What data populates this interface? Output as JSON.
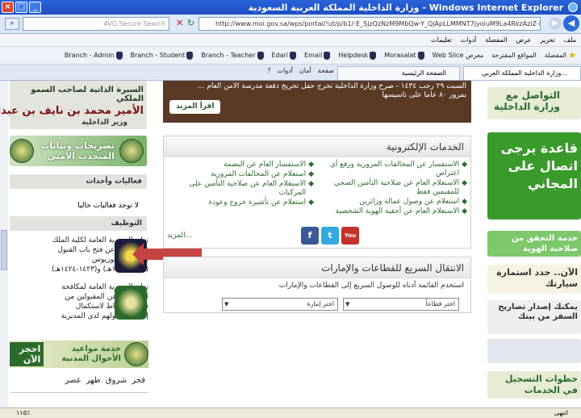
{
  "window": {
    "title": "وزارة الداخلية المملكة العربية السعودية - Windows Internet Explorer"
  },
  "address": {
    "url": "http://www.moi.gov.sa/wps/portal/!ut/p/b1/-E_SjzQzNzM9MbQw-Y_QjApLLMMNT7jyoiuM9La4RkzAziZ-DrD-!",
    "search_placeholder": "AVG Secure Search"
  },
  "menu": [
    "ملف",
    "تحرير",
    "عرض",
    "المفضلة",
    "أدوات",
    "تعليمات"
  ],
  "favorites": {
    "favorites_label": "المفضلة",
    "suggested_label": "المواقع المقترحة",
    "web_slice_label": "معرض Web Slice",
    "items": [
      "Morasalat",
      "Helpdesk",
      "Email",
      "Edari",
      "Branch - Teacher",
      "Branch - Student",
      "Branch - Admin"
    ]
  },
  "tabs": [
    {
      "label": "وزارة الداخلية المملكة العربي..."
    },
    {
      "label": "الصفحة الرئيسية"
    }
  ],
  "command_bar": [
    "صفحة",
    "أمان",
    "أدوات"
  ],
  "left": {
    "prince_line1": "السيرة الذاتية لصاحب السمو الملكي",
    "prince_line2": "الأمير محمد بن نايف بن عبدالعزيز",
    "prince_line3": "وزير الداخلية",
    "statements": "تصريحات وبيانات المتحدث الأمني",
    "events_header": "فعاليات وأحداث",
    "no_events": "لا توجد فعاليات حاليا",
    "jobs_header": "التوظيف",
    "job1": "تعلن المديرية العامة لكلية الملك فهد الأمنية عن فتح باب القبول لحملة البكالوريوس (١٤٣٢-١٤٣٣هـ) و(١٤٢٣-١٤٢٤هـ)",
    "job2": "تعلن المديرية العامة لمكافحة المخدرات عن المقبولين من قوائم الاحتياط لاستكمال إجراءات قبولهم لدى المديرية",
    "book_now": "احجز الآن",
    "book_text": "خدمة مواعيد الأحوال المدنية",
    "prayers": [
      "فجر",
      "شروق",
      "ظهر",
      "عصر"
    ]
  },
  "news": {
    "line1": "السبت ٢٩ رجب ١٤٣٤ - صرح وزارة الداخلية تخرج حفل تخريج دفعة مدرسة الأمن العام ...",
    "line2": "بمرور ٨٠ عاماً على تأسيسها",
    "more_label": "اقرأ المزيد"
  },
  "eservices": {
    "title": "الخدمات الإلكترونية",
    "col_right": [
      "الاستفسار عن المخالفات المرورية ورفع أي اعتراض",
      "الاستعلام العام عن صلاحية التأمين الصحي للمقيمين فقط",
      "استعلام عن وصول عمالة وزائرين",
      "الاستعلام العام عن أحقية الهوية الشخصية"
    ],
    "col_left": [
      "الاستفسار العام عن البصمة",
      "استعلام عن المخالفات المرورية",
      "الاستعلام العام عن صلاحية التأمين على المركبات",
      "استعلام عن تأشيرة خروج وعودة"
    ],
    "more_label": "المزيد...",
    "social": {
      "facebook": "f",
      "twitter": "t",
      "youtube": "You Tube"
    }
  },
  "quickgo": {
    "title": "الانتقال السريع للقطاعات والإمارات",
    "hint": "استخدم القائمة أدناه للوصول السريع إلى القطاعات والإمارات",
    "sector_select": "اختر قطاعاً",
    "emirate_select": "اختر إمارة"
  },
  "right": {
    "contact": "التواصل مع وزارة الداخلية",
    "promo": "قاعدة يرجى اتصال على المجاني",
    "verify": "خدمة التحقق من صلاحية الهوية",
    "sayarah": "الآن.. جدد استمارة سيارتك",
    "permit": "يمكنك إصدار تصاريح السفر من بيتك",
    "register": "خطوات التسجيل في الخدمات"
  },
  "status": {
    "text": "انتهى",
    "zoom": "١١٥٪"
  },
  "colors": {
    "titlebar": "#2a63d8",
    "accent_green": "#2c6b2c",
    "news_bg": "#5a3a25",
    "arrow": "#c64343"
  }
}
